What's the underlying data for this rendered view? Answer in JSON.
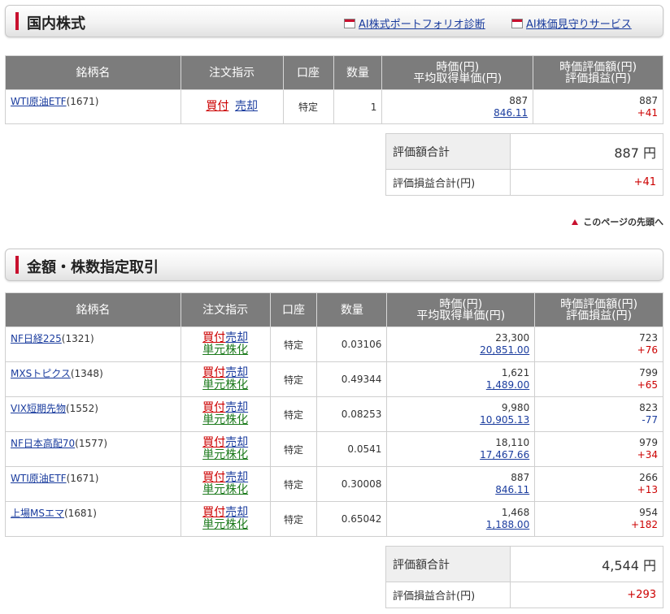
{
  "section1": {
    "title": "国内株式",
    "links": [
      "AI株式ポートフォリオ診断",
      "AI株価見守りサービス"
    ],
    "headers": {
      "name": "銘柄名",
      "order": "注文指示",
      "account": "口座",
      "qty": "数量",
      "price1": "時価(円)",
      "price2": "平均取得単価(円)",
      "value1": "時価評価額(円)",
      "value2": "評価損益(円)"
    },
    "rows": [
      {
        "name": "WTI原油ETF",
        "code": "(1671)",
        "buy": "買付",
        "sell": "売却",
        "account": "特定",
        "qty": "1",
        "price": "887",
        "avg": "846.11",
        "value": "887",
        "pl": "+41"
      }
    ],
    "summary": {
      "total_label": "評価額合計",
      "total_value": "887 円",
      "pl_label": "評価損益合計(円)",
      "pl_value": "+41"
    }
  },
  "page_top": "このページの先頭へ",
  "section2": {
    "title": "金額・株数指定取引",
    "headers": {
      "name": "銘柄名",
      "order": "注文指示",
      "account": "口座",
      "qty": "数量",
      "price1": "時価(円)",
      "price2": "平均取得単価(円)",
      "value1": "時価評価額(円)",
      "value2": "評価損益(円)"
    },
    "rows": [
      {
        "name": "NF日経225",
        "code": "(1321)",
        "buy": "買付",
        "sell": "売却",
        "unit": "単元株化",
        "account": "特定",
        "qty": "0.03106",
        "price": "23,300",
        "avg": "20,851.00",
        "value": "723",
        "pl": "+76"
      },
      {
        "name": "MXSトピクス",
        "code": "(1348)",
        "buy": "買付",
        "sell": "売却",
        "unit": "単元株化",
        "account": "特定",
        "qty": "0.49344",
        "price": "1,621",
        "avg": "1,489.00",
        "value": "799",
        "pl": "+65"
      },
      {
        "name": "VIX短期先物",
        "code": "(1552)",
        "buy": "買付",
        "sell": "売却",
        "unit": "単元株化",
        "account": "特定",
        "qty": "0.08253",
        "price": "9,980",
        "avg": "10,905.13",
        "value": "823",
        "pl": "-77"
      },
      {
        "name": "NF日本高配70",
        "code": "(1577)",
        "buy": "買付",
        "sell": "売却",
        "unit": "単元株化",
        "account": "特定",
        "qty": "0.0541",
        "price": "18,110",
        "avg": "17,467.66",
        "value": "979",
        "pl": "+34"
      },
      {
        "name": "WTI原油ETF",
        "code": "(1671)",
        "buy": "買付",
        "sell": "売却",
        "unit": "単元株化",
        "account": "特定",
        "qty": "0.30008",
        "price": "887",
        "avg": "846.11",
        "value": "266",
        "pl": "+13"
      },
      {
        "name": "上場MSエマ",
        "code": "(1681)",
        "buy": "買付",
        "sell": "売却",
        "unit": "単元株化",
        "account": "特定",
        "qty": "0.65042",
        "price": "1,468",
        "avg": "1,188.00",
        "value": "954",
        "pl": "+182"
      }
    ],
    "summary": {
      "total_label": "評価額合計",
      "total_value": "4,544 円",
      "pl_label": "評価損益合計(円)",
      "pl_value": "+293"
    }
  },
  "colors": {
    "accent_red": "#c8102e",
    "header_gray": "#7c7c7c",
    "link_blue": "#1a3c9e",
    "unit_green": "#1c7a1c"
  }
}
